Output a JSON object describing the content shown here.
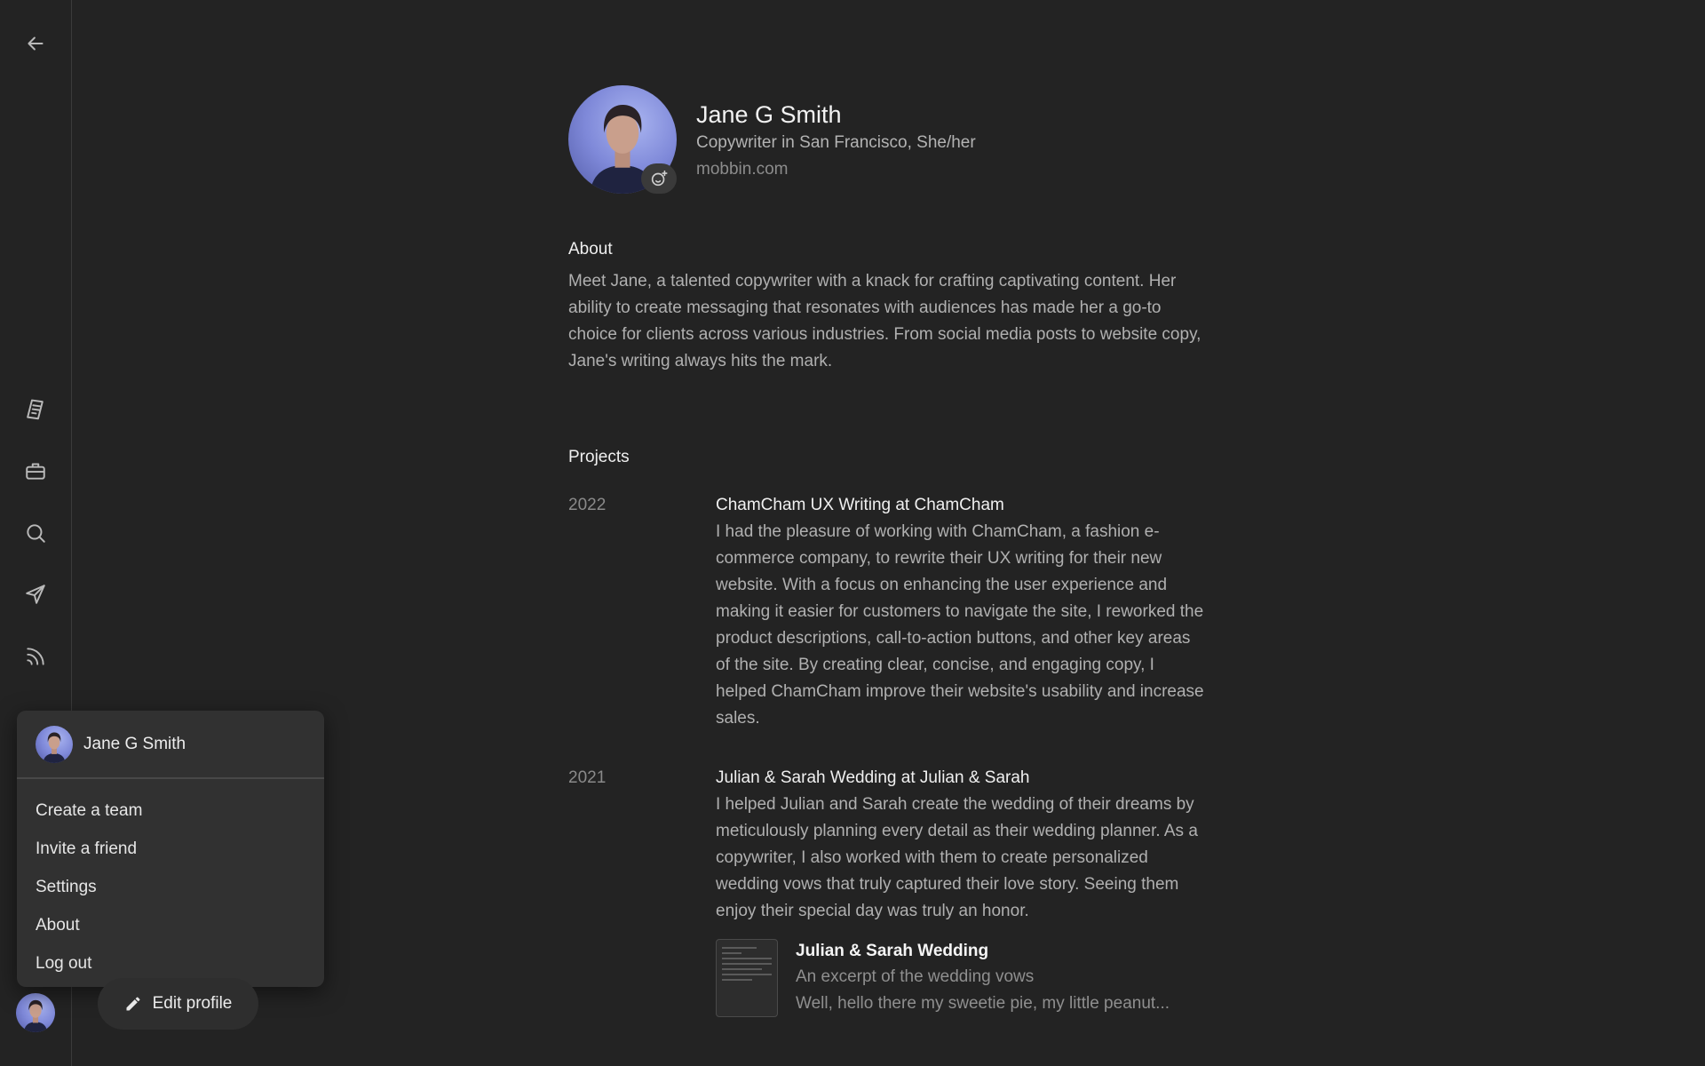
{
  "nav": {
    "icons": [
      "back-arrow-icon",
      "notes-icon",
      "briefcase-icon",
      "search-icon",
      "send-icon",
      "feed-icon"
    ]
  },
  "profile": {
    "name": "Jane G Smith",
    "role": "Copywriter in San Francisco, She/her",
    "website": "mobbin.com"
  },
  "about": {
    "title": "About",
    "body": "Meet Jane, a talented copywriter with a knack for crafting captivating content. Her ability to create messaging that resonates with audiences has made her a go-to choice for clients across various industries. From social media posts to website copy, Jane's writing always hits the mark."
  },
  "projects": {
    "title": "Projects",
    "items": [
      {
        "year": "2022",
        "name": "ChamCham UX Writing at ChamCham",
        "description": "I had the pleasure of working with ChamCham, a fashion e-commerce company, to rewrite their UX writing for their new website. With a focus on enhancing the user experience and making it easier for customers to navigate the site, I reworked the product descriptions, call-to-action buttons, and other key areas of the site. By creating clear, concise, and engaging copy, I helped ChamCham improve their website's usability and increase sales."
      },
      {
        "year": "2021",
        "name": "Julian & Sarah Wedding at Julian & Sarah",
        "description": "I helped Julian and Sarah create the wedding of their dreams by meticulously planning every detail as their wedding planner. As a copywriter, I also worked with them to create personalized wedding vows that truly captured their love story. Seeing them enjoy their special day was truly an honor.",
        "attachment": {
          "title": "Julian & Sarah Wedding",
          "subtitle": "An excerpt of the wedding vows",
          "preview": "Well, hello there my sweetie pie, my little peanut..."
        }
      }
    ]
  },
  "menu": {
    "user_name": "Jane G Smith",
    "items": [
      "Create a team",
      "Invite a friend",
      "Settings",
      "About",
      "Log out"
    ]
  },
  "edit_profile": {
    "label": "Edit profile"
  }
}
